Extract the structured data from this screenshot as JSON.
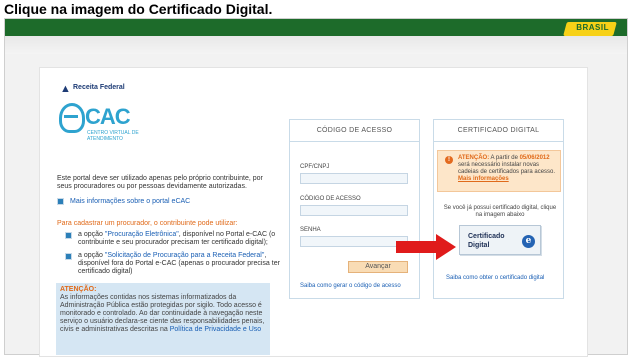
{
  "page_title": "Clique na imagem do Certificado Digital.",
  "header": {
    "brasil_badge": "BRASIL",
    "colors": {
      "gov_green": "#1d6b2a",
      "brasil_yellow": "#f7d117"
    }
  },
  "logo": {
    "receita": "Receita Federal",
    "ecac_cac": "CAC",
    "ecac_subtitle": "CENTRO VIRTUAL DE ATENDIMENTO"
  },
  "intro": {
    "description": "Este portal deve ser utilizado apenas pelo próprio contribuinte, por seus procuradores ou por pessoas devidamente autorizadas.",
    "more_info_link": "Mais informações sobre o portal eCAC",
    "cadastrar_title": "Para cadastrar um procurador, o contribuinte pode utilizar:",
    "option1_prefix": "a opção ",
    "option1_link": "\"Procuração Eletrônica\"",
    "option1_suffix": ", disponível no Portal e-CAC (o contribuinte e seu procurador precisam ter certificado digital);",
    "option2_prefix": "a opção ",
    "option2_link": "\"Solicitação de Procuração para a Receita Federal\"",
    "option2_suffix": ", disponível fora do Portal e-CAC (apenas o procurador precisa ter certificado digital)"
  },
  "attention": {
    "title": "ATENÇÃO:",
    "text": "As informações contidas nos sistemas informatizados da Administração Pública estão protegidas por sigilo. Todo acesso é monitorado e controlado. Ao dar continuidade à navegação neste serviço o usuário declara-se ciente das responsabilidades penais, civis e administrativas descritas na ",
    "link": "Política de Privacidade e Uso"
  },
  "codigo_acesso": {
    "header": "CÓDIGO DE ACESSO",
    "cpf_label": "CPF/CNPJ",
    "codigo_label": "CÓDIGO DE ACESSO",
    "senha_label": "SENHA",
    "cpf_value": "",
    "codigo_value": "",
    "senha_value": "",
    "button": "Avançar",
    "help_link": "Saiba como gerar o código de acesso"
  },
  "certificado": {
    "header": "CERTIFICADO DIGITAL",
    "warning_title": "ATENÇÃO:",
    "warning_prefix": " A partir de ",
    "warning_date": "05/06/2012",
    "warning_text": " será necessário instalar novas cadeias de certificados para acesso.",
    "warning_link": "Mais informações",
    "info": "Se você já possui certificado digital, clique na imagem abaixo",
    "cert_button_text": "Certificado Digital",
    "cert_icon": "e",
    "help_link": "Saiba como obter o certificado digital"
  }
}
